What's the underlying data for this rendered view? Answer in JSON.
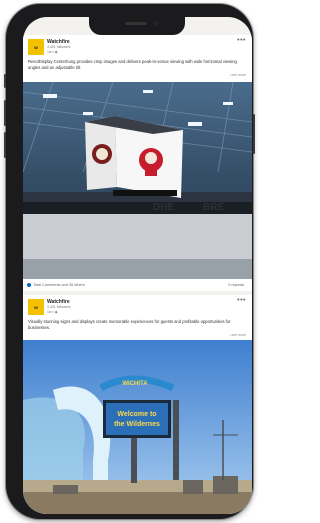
{
  "post1": {
    "author": "Watchfire",
    "logo_text": "W",
    "followers": "4,421 followers",
    "meta": "1w • ◉",
    "more": "•••",
    "caption": "ResolDisplay Centerhung provides crisp images and delivers peak-to-venue viewing with wide horizontal viewing angles and an adjustable tilt.",
    "see_more": "...see more",
    "likes": "Total Comments and 35 others",
    "shares": "5 reposts"
  },
  "post2": {
    "author": "Watchfire",
    "logo_text": "W",
    "followers": "4,421 followers",
    "meta": "1w • ◉",
    "more": "•••",
    "caption": "Visually stunning signs and displays create memorable experiences for guests and profitable opportunities for businesses.",
    "see_more": "...see more",
    "sign_arch": "WICHITA",
    "sign_text1": "Welcome to",
    "sign_text2": "the Wildernes"
  },
  "colors": {
    "logo": "#f2c200",
    "link_blue": "#0a66c2",
    "sky": "#5f9bd8"
  }
}
